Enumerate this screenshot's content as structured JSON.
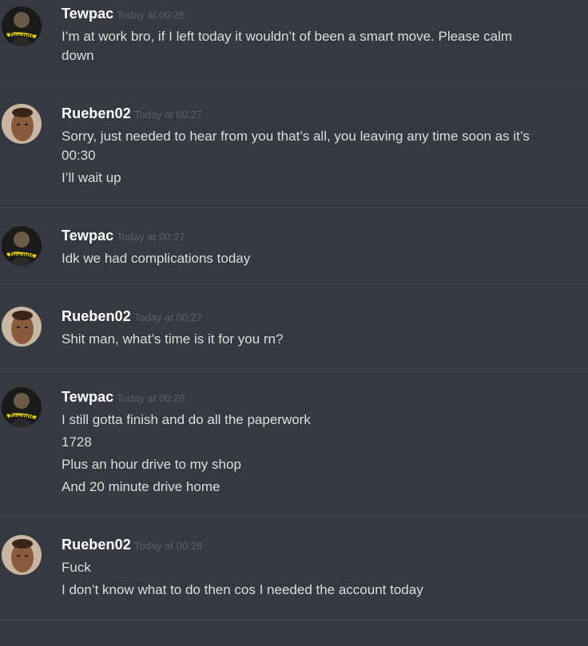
{
  "messages": [
    {
      "username": "Tewpac",
      "timestamp": "Today at 00:26",
      "avatar": "tupac-avatar",
      "lines": [
        "I’m at work bro, if I left today it wouldn’t of been a smart move. Please calm",
        "down"
      ]
    },
    {
      "username": "Rueben02",
      "timestamp": "Today at 00:27",
      "avatar": "face-photo-avatar",
      "lines": [
        "Sorry, just needed to hear from you that’s all, you leaving any time soon as it’s",
        "00:30",
        "I’ll wait up"
      ]
    },
    {
      "username": "Tewpac",
      "timestamp": "Today at 00:27",
      "avatar": "tupac-avatar",
      "lines": [
        "Idk we had complications today"
      ]
    },
    {
      "username": "Rueben02",
      "timestamp": "Today at 00:27",
      "avatar": "face-photo-avatar",
      "lines": [
        "Shit man, what’s time is it for you rn?"
      ]
    },
    {
      "username": "Tewpac",
      "timestamp": "Today at 00:28",
      "avatar": "tupac-avatar",
      "lines": [
        "I still gotta finish and do all the paperwork",
        "1728",
        "Plus an hour drive to my shop",
        "And 20 minute drive home"
      ]
    },
    {
      "username": "Rueben02",
      "timestamp": "Today at 00:28",
      "avatar": "face-photo-avatar",
      "lines": [
        "Fuck",
        "I don’t know what to do then cos I needed the account today"
      ]
    }
  ],
  "colors": {
    "background": "#36393f",
    "username": "#ffffff",
    "timestamp": "#5f6166",
    "message_text": "#dcddde",
    "divider": "#42454a"
  }
}
